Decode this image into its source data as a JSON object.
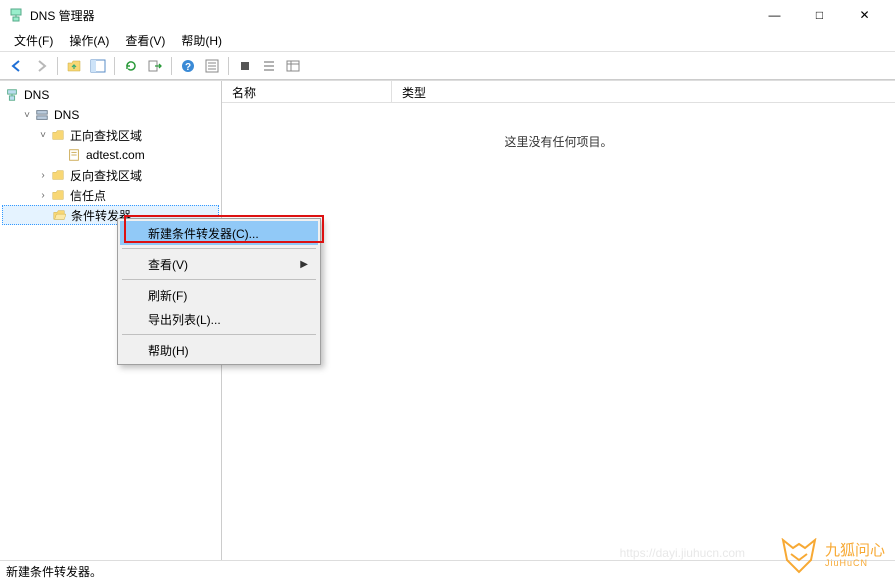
{
  "window": {
    "title": "DNS 管理器",
    "minimize": "—",
    "maximize": "□",
    "close": "✕"
  },
  "menubar": {
    "file": "文件(F)",
    "action": "操作(A)",
    "view": "查看(V)",
    "help": "帮助(H)"
  },
  "toolbar": {
    "back": "←",
    "forward": "→",
    "up": "↑",
    "new_window": "▭",
    "refresh2": "⟳",
    "export": "⇨",
    "help": "?",
    "props": "▤",
    "stop": "■",
    "list1": "≣",
    "list2": "▦"
  },
  "tree": {
    "root": "DNS",
    "server": "DNS",
    "forward": "正向查找区域",
    "zone1": "adtest.com",
    "reverse": "反向查找区域",
    "trust": "信任点",
    "conditional": "条件转发器"
  },
  "columns": {
    "name": "名称",
    "type": "类型"
  },
  "empty": "这里没有任何项目。",
  "context": {
    "new_cf": "新建条件转发器(C)...",
    "view": "查看(V)",
    "refresh": "刷新(F)",
    "export": "导出列表(L)...",
    "help": "帮助(H)"
  },
  "status": "新建条件转发器。",
  "watermark": {
    "name": "九狐问心",
    "sub": "JiuHuCN"
  },
  "faint_url": "https://dayi.jiuhucn.com"
}
